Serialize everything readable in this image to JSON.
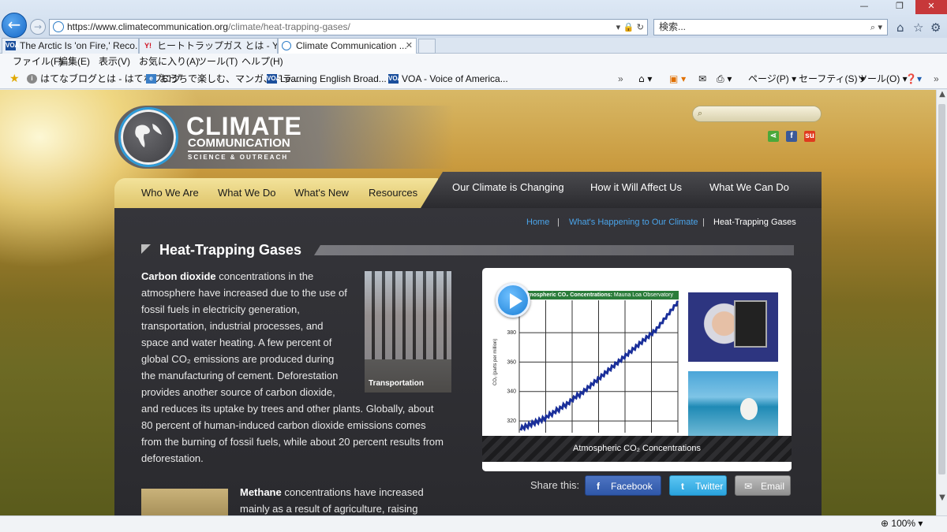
{
  "browser": {
    "address": {
      "domain": "https://www.climatecommunication.org",
      "path": "/climate/heat-trapping-gases/"
    },
    "search_placeholder": "検索...",
    "tabs": [
      {
        "label": "The Arctic Is 'on Fire,' Reco...",
        "icon": "VOA"
      },
      {
        "label": "ヒートトラップガス とは - Yahoo!...",
        "icon": "Y!"
      },
      {
        "label": "Climate Communication ...",
        "icon": "globe"
      }
    ],
    "menu": [
      "ファイル(F)",
      "編集(E)",
      "表示(V)",
      "お気に入り(A)",
      "ツール(T)",
      "ヘルプ(H)"
    ],
    "favorites": [
      "はてなブログとは - はてなブログ",
      "おうちで楽しむ、マンガ、ドラ...",
      "Learning English Broad...",
      "VOA - Voice of America..."
    ],
    "commands": [
      "ページ(P) ▾",
      "セーフティ(S) ▾",
      "ツール(O) ▾"
    ],
    "zoom": "100%",
    "overflow": "»"
  },
  "site": {
    "logo": {
      "line1": "CLIMATE",
      "line2": "COMMUNICATION",
      "line3": "SCIENCE & OUTREACH"
    },
    "nav_left": [
      "Who We Are",
      "What We Do",
      "What's New",
      "Resources"
    ],
    "nav_right": [
      "Our Climate is Changing",
      "How it Will Affect Us",
      "What We Can Do"
    ],
    "breadcrumb": {
      "home": "Home",
      "sep": "|",
      "parent": "What's Happening to Our Climate",
      "current": "Heat-Trapping Gases"
    },
    "page_title": "Heat-Trapping Gases",
    "co2_para": {
      "bold": "Carbon dioxide",
      "lines": [
        " concentrations in the",
        "atmosphere have increased due to the use of",
        "fossil fuels in electricity generation,",
        "transportation, industrial processes, and",
        "space and water heating. A few percent of",
        "global CO₂ emissions are produced during",
        "the manufacturing of cement. Deforestation",
        "provides another source of carbon dioxide,",
        "and reduces its uptake by trees and other plants. Globally, about",
        "80 percent of human-induced carbon dioxide emissions comes",
        "from the burning of fossil fuels, while about 20 percent results from",
        "deforestation."
      ]
    },
    "methane_para": {
      "bold": "Methane",
      "lines": [
        " concentrations have increased",
        "mainly as a result of agriculture, raising"
      ]
    },
    "thumb_caption": "Transportation",
    "video": {
      "chart_title_bold": "Atmospheric CO₂ Concentrations:",
      "chart_title_rest": " Mauna Loa Observatory",
      "ylabel": "CO₂ (parts per million)",
      "yticks": [
        "380",
        "360",
        "340",
        "320"
      ],
      "caption": "Atmospheric CO₂ Concentrations"
    },
    "share": {
      "label": "Share this:",
      "facebook": "Facebook",
      "twitter": "Twitter",
      "email": "Email"
    }
  },
  "chart_data": {
    "type": "line",
    "title": "Atmospheric CO₂ Concentrations: Mauna Loa Observatory",
    "ylabel": "CO₂ (parts per million)",
    "ylim": [
      312,
      402
    ],
    "yticks": [
      320,
      340,
      360,
      380
    ],
    "series": [
      {
        "values": [
          315,
          316,
          317,
          318,
          319,
          320,
          321,
          322,
          324,
          325,
          327,
          328,
          330,
          331,
          333,
          335,
          337,
          338,
          340,
          342,
          344,
          346,
          348,
          350,
          352,
          354,
          356,
          358,
          360,
          362,
          364,
          366,
          368,
          370,
          372,
          374,
          376,
          378,
          380,
          382,
          385,
          388,
          391,
          394,
          397,
          400
        ]
      }
    ],
    "grid": true
  }
}
